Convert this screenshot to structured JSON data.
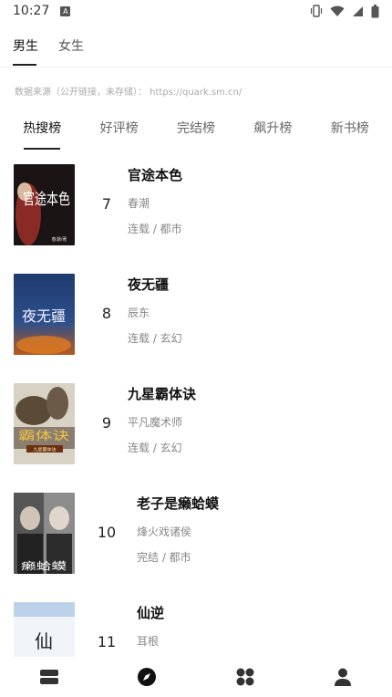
{
  "status": {
    "time": "10:27",
    "notif_glyph": "A"
  },
  "gender_tabs": [
    {
      "label": "男生",
      "active": true
    },
    {
      "label": "女生",
      "active": false
    }
  ],
  "source_note": "数据来源（公开链接，未存储）：  https://quark.sm.cn/",
  "rank_tabs": [
    {
      "label": "热搜榜",
      "active": true
    },
    {
      "label": "好评榜",
      "active": false
    },
    {
      "label": "完结榜",
      "active": false
    },
    {
      "label": "飙升榜",
      "active": false
    },
    {
      "label": "新书榜",
      "active": false
    }
  ],
  "books": [
    {
      "rank": "7",
      "title": "官途本色",
      "author": "春潮",
      "meta": "连载 / 都市",
      "cover_text": "官途本色",
      "cover_sub": "春潮/著"
    },
    {
      "rank": "8",
      "title": "夜无疆",
      "author": "辰东",
      "meta": "连载 / 玄幻",
      "cover_text": "夜无疆"
    },
    {
      "rank": "9",
      "title": "九星霸体诀",
      "author": "平凡魔术师",
      "meta": "连载 / 玄幻",
      "cover_text": "霸体诀",
      "cover_sub": "九星霸体诀"
    },
    {
      "rank": "10",
      "title": "老子是癞蛤蟆",
      "author": "烽火戏诸侯",
      "meta": "完结 / 都市",
      "cover_text": "癞蛤蟆"
    },
    {
      "rank": "11",
      "title": "仙逆",
      "author": "耳根",
      "meta": "",
      "cover_text": "仙"
    }
  ],
  "nav": [
    {
      "icon": "bookshelf-icon"
    },
    {
      "icon": "compass-icon"
    },
    {
      "icon": "apps-icon"
    },
    {
      "icon": "profile-icon"
    }
  ],
  "colors": {
    "text": "#222222",
    "muted": "#888888",
    "accent": "#222222"
  }
}
